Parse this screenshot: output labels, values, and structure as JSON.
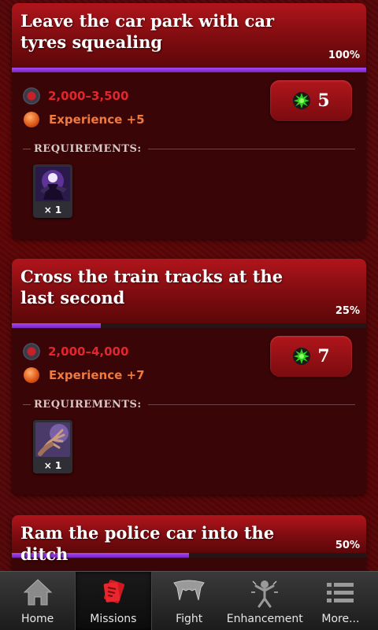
{
  "missions": [
    {
      "title": "Leave the car park with car tyres squealing",
      "progress_percent": 100,
      "progress_label": "100%",
      "money_reward": "2,000–3,500",
      "experience_reward": "Experience +5",
      "energy_cost": "5",
      "requirements_label": "REQUIREMENTS:",
      "requirement": {
        "icon": "vampire-figure-icon",
        "quantity": "× 1"
      }
    },
    {
      "title": "Cross the train tracks at the last second",
      "progress_percent": 25,
      "progress_label": "25%",
      "money_reward": "2,000–4,000",
      "experience_reward": "Experience +7",
      "energy_cost": "7",
      "requirements_label": "REQUIREMENTS:",
      "requirement": {
        "icon": "clawed-hand-icon",
        "quantity": "× 1"
      }
    },
    {
      "title": "Ram the police car into the ditch",
      "progress_percent": 50,
      "progress_label": "50%"
    }
  ],
  "nav": {
    "items": [
      {
        "label": "Home",
        "icon": "house-icon",
        "active": false
      },
      {
        "label": "Missions",
        "icon": "missions-card-icon",
        "active": true
      },
      {
        "label": "Fight",
        "icon": "fangs-icon",
        "active": false
      },
      {
        "label": "Enhancement",
        "icon": "enhancement-figure-icon",
        "active": false
      },
      {
        "label": "More...",
        "icon": "list-icon",
        "active": false
      }
    ]
  },
  "colors": {
    "progress_fill": "#8e35dc",
    "money_text": "#e2262e",
    "experience_text": "#f07a3c",
    "card_header": "#9c1117",
    "energy_icon": "#2fd41a"
  }
}
